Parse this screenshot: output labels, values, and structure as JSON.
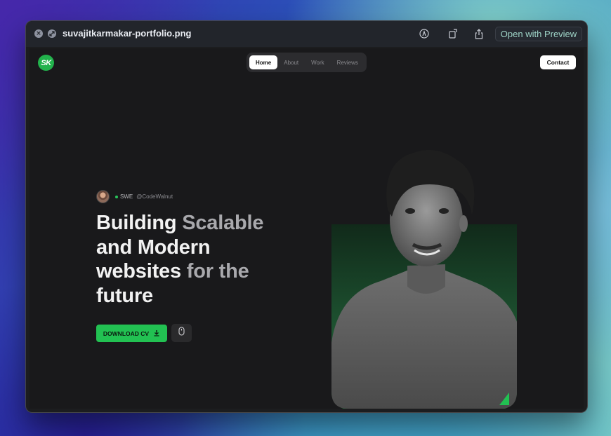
{
  "window": {
    "title": "suvajitkarmakar-portfolio.png",
    "open_with_label": "Open with Preview"
  },
  "site": {
    "logo_text": "SK",
    "nav": [
      {
        "label": "Home",
        "active": true
      },
      {
        "label": "About",
        "active": false
      },
      {
        "label": "Work",
        "active": false
      },
      {
        "label": "Reviews",
        "active": false
      }
    ],
    "contact_label": "Contact",
    "badge": {
      "role": "SWE",
      "handle": "@CodeWalnut"
    },
    "headline": {
      "l1a": "Building ",
      "l1b": "Scalable",
      "l2": "and Modern",
      "l3a": "websites ",
      "l3b": "for the",
      "l4": "future"
    },
    "download_label": "DOWNLOAD CV"
  },
  "colors": {
    "accent_green": "#22c152",
    "page_bg": "#19191b"
  },
  "icons": [
    "close-icon",
    "fullscreen-icon",
    "markup-icon",
    "rotate-icon",
    "share-icon",
    "download-icon",
    "mouse-icon"
  ]
}
